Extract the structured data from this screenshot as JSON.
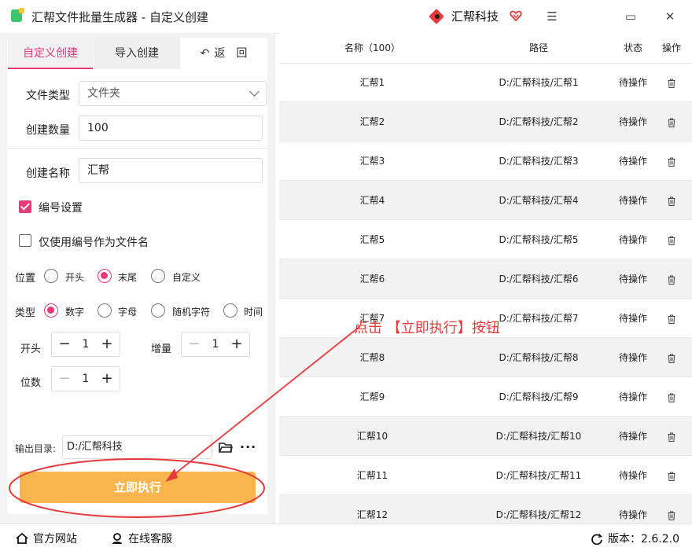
{
  "window": {
    "title": "汇帮文件批量生成器 - 自定义创建",
    "brand": "汇帮科技",
    "minimize": "☰",
    "restore": "▭",
    "close": "✕"
  },
  "left": {
    "tabs": {
      "custom": "自定义创建",
      "import": "导入创建",
      "back": "返　回"
    },
    "file_type_label": "文件类型",
    "file_type_value": "文件夹",
    "count_label": "创建数量",
    "count_value": "100",
    "name_label": "创建名称",
    "name_value": "汇帮",
    "numbering_label": "编号设置",
    "numbering_checked": true,
    "only_number_label": "仅使用编号作为文件名",
    "only_number_checked": false,
    "position_label": "位置",
    "position_options": [
      "开头",
      "末尾",
      "自定义"
    ],
    "position_selected": "末尾",
    "type_label": "类型",
    "type_options": [
      "数字",
      "字母",
      "随机字符",
      "时间"
    ],
    "type_selected": "数字",
    "start_label": "开头",
    "start_value": "1",
    "increment_label": "增量",
    "increment_value": "1",
    "digits_label": "位数",
    "digits_value": "1",
    "output_label": "输出目录:",
    "output_value": "D:/汇帮科技",
    "execute_label": "立即执行"
  },
  "table": {
    "headers": {
      "name": "名称（100）",
      "path": "路径",
      "status": "状态",
      "op": "操作"
    },
    "rows": [
      {
        "name": "汇帮1",
        "path": "D:/汇帮科技/汇帮1",
        "status": "待操作"
      },
      {
        "name": "汇帮2",
        "path": "D:/汇帮科技/汇帮2",
        "status": "待操作"
      },
      {
        "name": "汇帮3",
        "path": "D:/汇帮科技/汇帮3",
        "status": "待操作"
      },
      {
        "name": "汇帮4",
        "path": "D:/汇帮科技/汇帮4",
        "status": "待操作"
      },
      {
        "name": "汇帮5",
        "path": "D:/汇帮科技/汇帮5",
        "status": "待操作"
      },
      {
        "name": "汇帮6",
        "path": "D:/汇帮科技/汇帮6",
        "status": "待操作"
      },
      {
        "name": "汇帮7",
        "path": "D:/汇帮科技/汇帮7",
        "status": "待操作"
      },
      {
        "name": "汇帮8",
        "path": "D:/汇帮科技/汇帮8",
        "status": "待操作"
      },
      {
        "name": "汇帮9",
        "path": "D:/汇帮科技/汇帮9",
        "status": "待操作"
      },
      {
        "name": "汇帮10",
        "path": "D:/汇帮科技/汇帮10",
        "status": "待操作"
      },
      {
        "name": "汇帮11",
        "path": "D:/汇帮科技/汇帮11",
        "status": "待操作"
      },
      {
        "name": "汇帮12",
        "path": "D:/汇帮科技/汇帮12",
        "status": "待操作"
      }
    ]
  },
  "annotation": "点击 【立即执行】按钮",
  "bottom": {
    "website": "官方网站",
    "support": "在线客服",
    "version": "版本：2.6.2.0"
  },
  "colors": {
    "accent": "#e83a74",
    "button": "#fbb54f",
    "annotation": "#e8393a"
  }
}
